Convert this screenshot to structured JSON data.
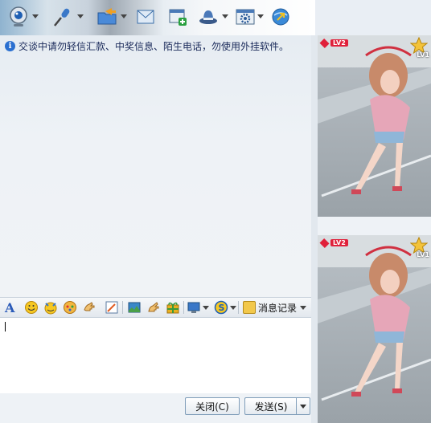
{
  "toolbar": {
    "buttons": [
      {
        "name": "video-call-button",
        "icon": "webcam-icon",
        "dropdown": true
      },
      {
        "name": "voice-call-button",
        "icon": "microphone-icon",
        "dropdown": true
      },
      {
        "name": "send-file-button",
        "icon": "folder-send-icon",
        "dropdown": true
      },
      {
        "name": "send-sms-button",
        "icon": "envelope-icon",
        "dropdown": false
      },
      {
        "name": "create-group-button",
        "icon": "add-window-icon",
        "dropdown": false
      },
      {
        "name": "remote-assist-button",
        "icon": "hat-icon",
        "dropdown": true
      },
      {
        "name": "app-settings-button",
        "icon": "gear-window-icon",
        "dropdown": true
      },
      {
        "name": "share-button",
        "icon": "globe-arrow-icon",
        "dropdown": false
      }
    ]
  },
  "notice": {
    "text": "交谈中请勿轻信汇款、中奖信息、陌生电话，勿使用外挂软件。"
  },
  "format_bar": {
    "history_label": "消息记录"
  },
  "buttons": {
    "close_label": "关闭(C)",
    "send_label": "发送(S)"
  },
  "profile": {
    "top_level": "LV2",
    "top_rank": "LV1",
    "bottom_level": "LV2",
    "bottom_rank": "LV1"
  },
  "colors": {
    "accent": "#2a6fd0",
    "level_badge": "#e0203a"
  }
}
